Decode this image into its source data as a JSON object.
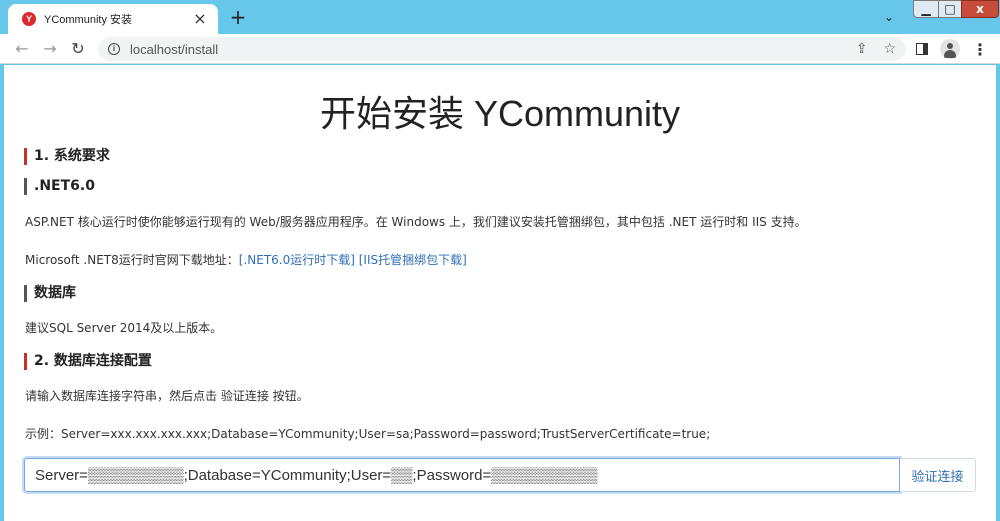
{
  "browser": {
    "tab_title": "YCommunity 安装",
    "favicon_letter": "Y",
    "tab_close": "×",
    "new_tab": "+",
    "tab_list": "⌄",
    "url": "localhost/install",
    "win_min": "▁",
    "win_max": "□",
    "win_close": "x",
    "back": "←",
    "forward": "→",
    "reload": "↻",
    "share_icon": "⇪",
    "star_icon": "☆",
    "menu_icon": "⋮"
  },
  "page": {
    "title": "开始安装 YCommunity",
    "section1": "1. 系统要求",
    "net_heading": ".NET6.0",
    "net_desc": "ASP.NET 核心运行时使你能够运行现有的 Web/服务器应用程序。在 Windows 上，我们建议安装托管捆绑包，其中包括 .NET 运行时和 IIS 支持。",
    "download_prefix": "Microsoft .NET8运行时官网下载地址：",
    "download_link1": "[.NET6.0运行时下载]",
    "download_link2": "[IIS托管捆绑包下载]",
    "db_heading": "数据库",
    "db_desc": "建议SQL Server 2014及以上版本。",
    "section2": "2. 数据库连接配置",
    "conn_instruction": "请输入数据库连接字符串，然后点击 验证连接 按钮。",
    "conn_example": "示例：Server=xxx.xxx.xxx.xxx;Database=YCommunity;User=sa;Password=password;TrustServerCertificate=true;",
    "conn_value": "Server=▒▒▒▒▒▒▒▒▒;Database=YCommunity;User=▒▒;Password=▒▒▒▒▒▒▒▒▒▒",
    "verify_button": "验证连接"
  }
}
